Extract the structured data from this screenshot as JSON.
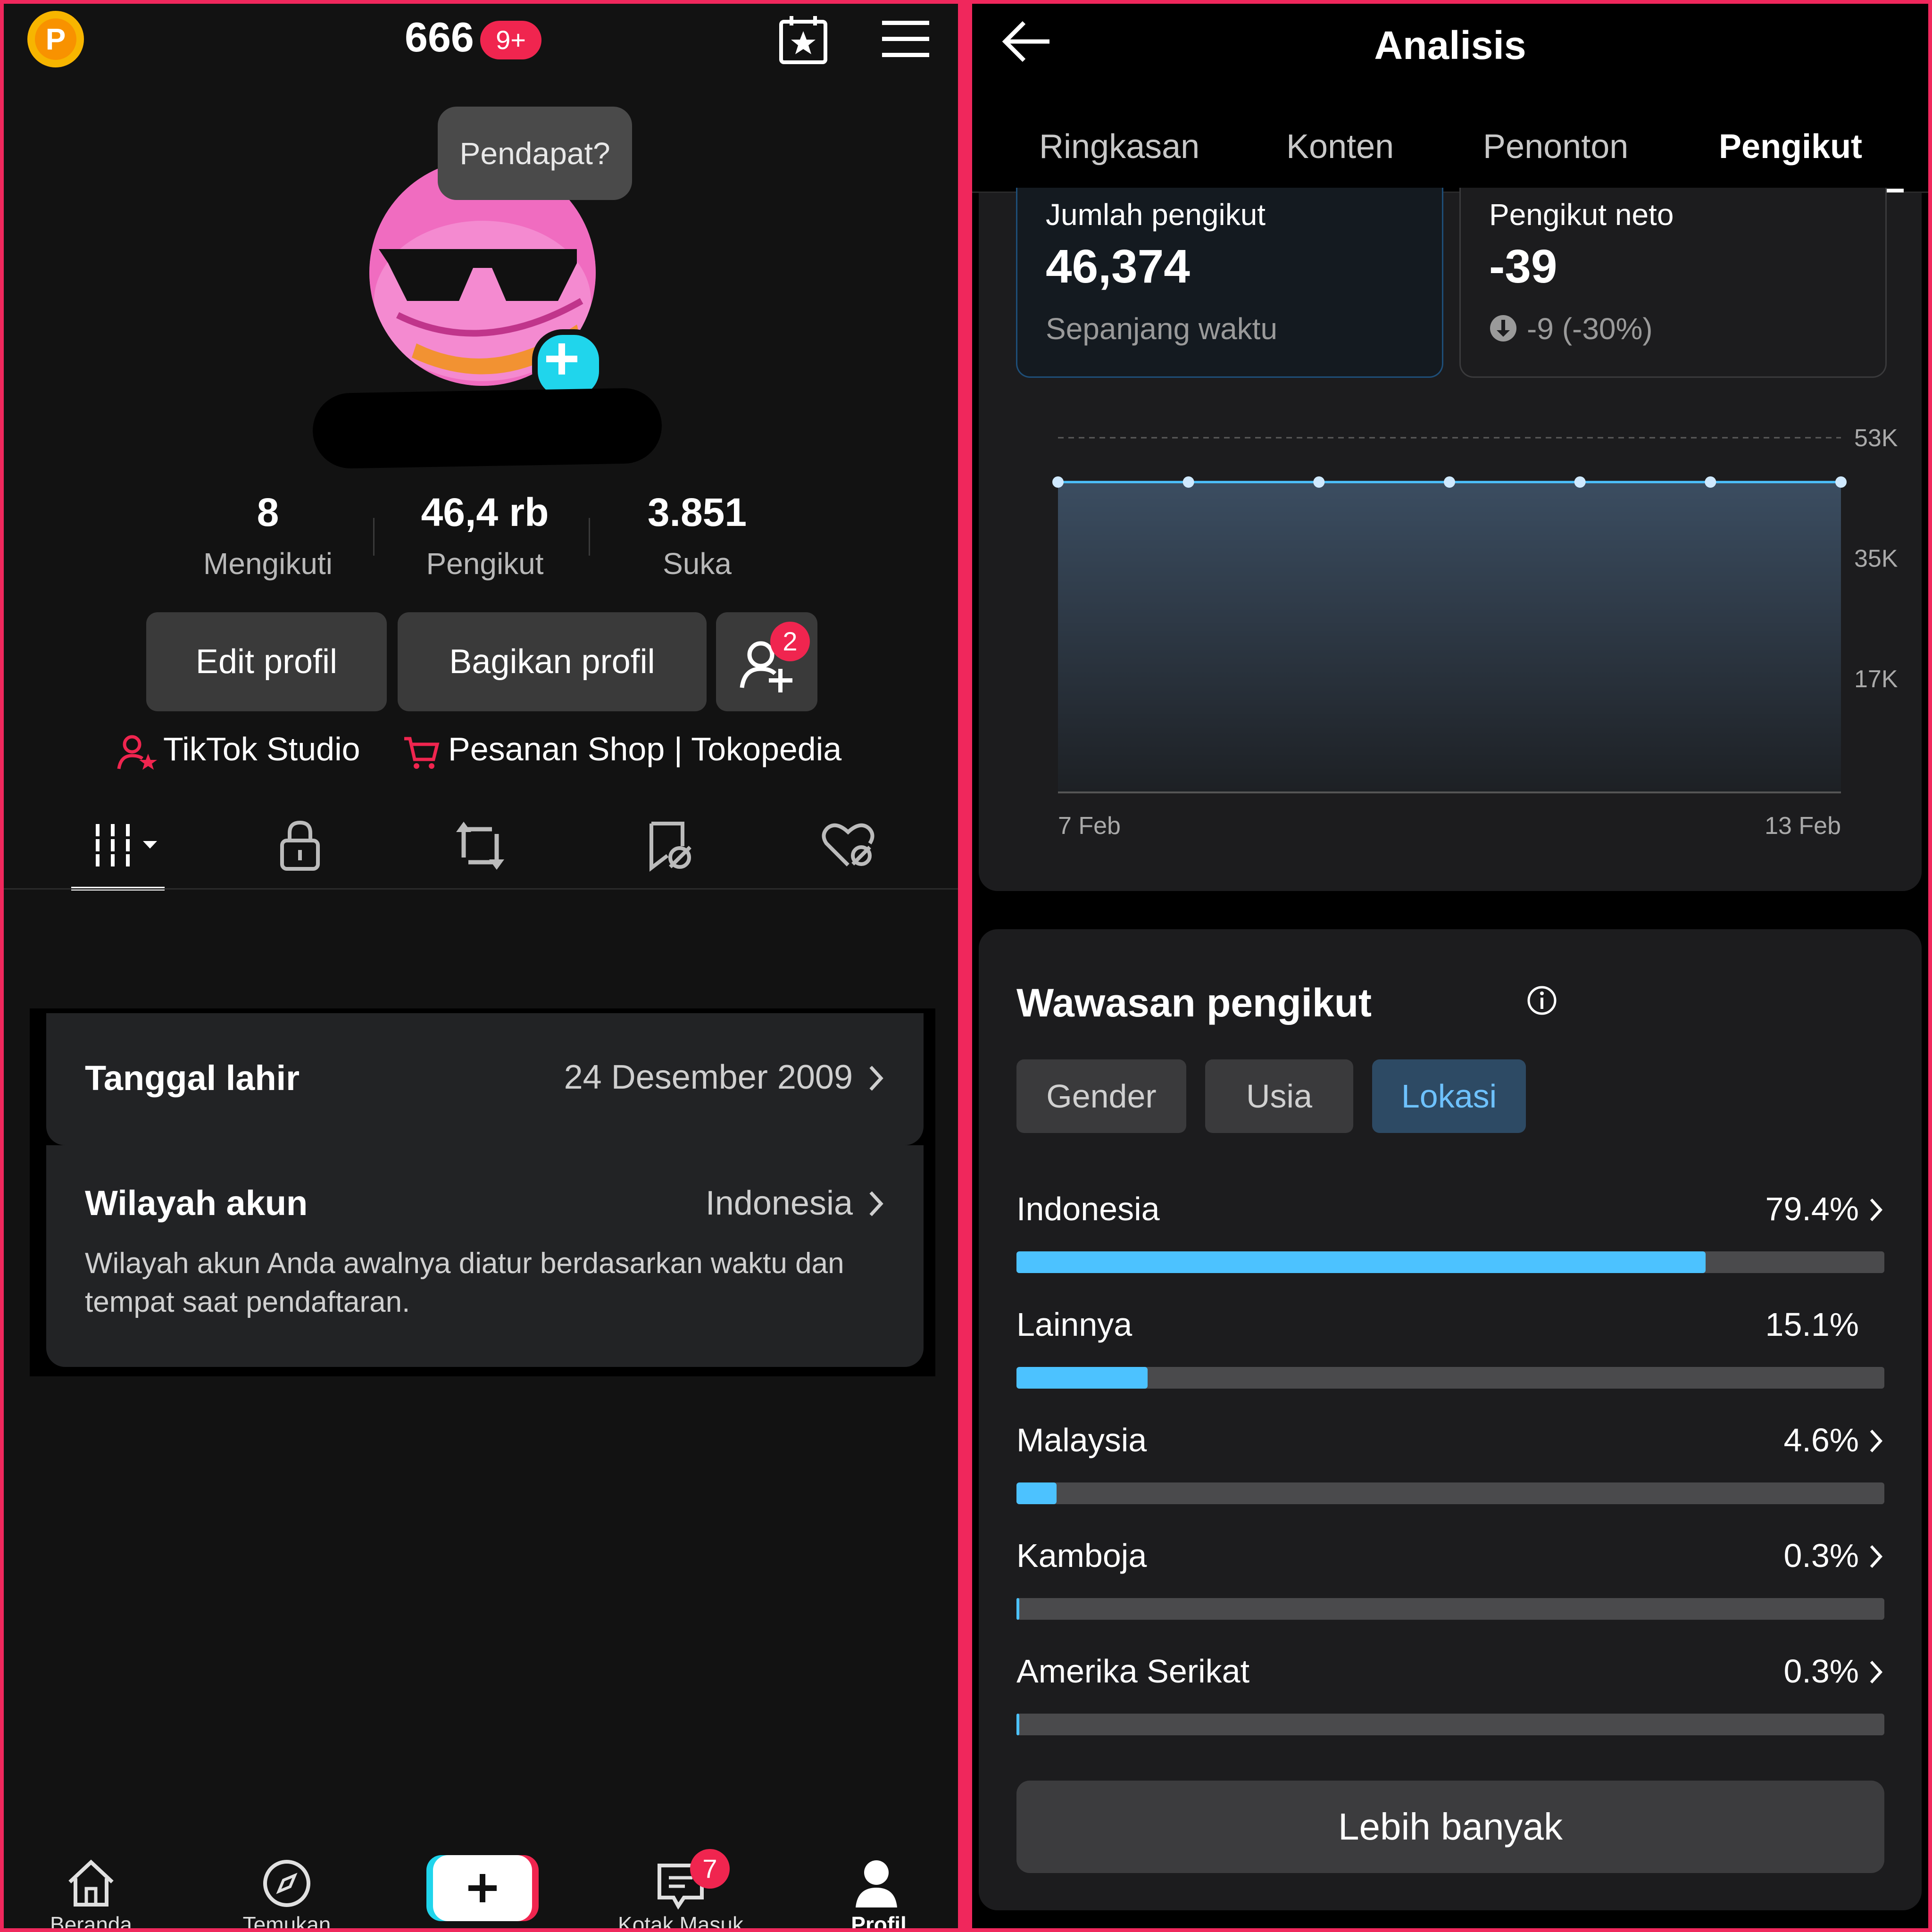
{
  "left": {
    "topbar": {
      "coin_label": "P",
      "count": "666",
      "count_badge": "9+"
    },
    "tooltip": "Pendapat?",
    "stats": [
      {
        "num": "8",
        "label": "Mengikuti"
      },
      {
        "num": "46,4 rb",
        "label": "Pengikut"
      },
      {
        "num": "3.851",
        "label": "Suka"
      }
    ],
    "buttons": {
      "edit": "Edit profil",
      "share": "Bagikan profil",
      "friend_badge": "2"
    },
    "links": {
      "studio": "TikTok Studio",
      "shop": "Pesanan Shop | Tokopedia"
    },
    "tab_icons": [
      "grid-icon",
      "lock-icon",
      "repost-icon",
      "bookmark-icon",
      "liked-icon"
    ],
    "birthday": {
      "title": "Tanggal lahir",
      "value": "24 Desember 2009"
    },
    "region": {
      "title": "Wilayah akun",
      "value": "Indonesia",
      "desc_line1": "Wilayah akun Anda awalnya diatur berdasarkan waktu dan",
      "desc_line2": "tempat saat pendaftaran."
    },
    "nav": {
      "home": "Beranda",
      "discover": "Temukan",
      "inbox": "Kotak Masuk",
      "inbox_badge": "7",
      "profile": "Profil"
    }
  },
  "right": {
    "title": "Analisis",
    "tabs": [
      "Ringkasan",
      "Konten",
      "Penonton",
      "Pengikut"
    ],
    "active_tab": "Pengikut",
    "total_card": {
      "label": "Jumlah pengikut",
      "value": "46,374",
      "sub": "Sepanjang waktu"
    },
    "net_card": {
      "label": "Pengikut neto",
      "value": "-39",
      "sub": "-9 (-30%)"
    },
    "chart_data": {
      "type": "area",
      "x": [
        "7 Feb",
        "8 Feb",
        "9 Feb",
        "10 Feb",
        "11 Feb",
        "12 Feb",
        "13 Feb"
      ],
      "x_tick_labels": [
        "7 Feb",
        "13 Feb"
      ],
      "values": [
        46374,
        46374,
        46374,
        46374,
        46374,
        46374,
        46374
      ],
      "y_ticks": [
        "53K",
        "35K",
        "17K"
      ],
      "ylim": [
        0,
        53000
      ],
      "grid": true,
      "title": "",
      "xlabel": "",
      "ylabel": ""
    },
    "insights": {
      "title": "Wawasan pengikut",
      "filters": [
        "Gender",
        "Usia",
        "Lokasi"
      ],
      "active_filter": "Lokasi",
      "locations": [
        {
          "name": "Indonesia",
          "pct": "79.4%",
          "value": 79.4,
          "chevron": true
        },
        {
          "name": "Lainnya",
          "pct": "15.1%",
          "value": 15.1,
          "chevron": false
        },
        {
          "name": "Malaysia",
          "pct": "4.6%",
          "value": 4.6,
          "chevron": true
        },
        {
          "name": "Kamboja",
          "pct": "0.3%",
          "value": 0.3,
          "chevron": true
        },
        {
          "name": "Amerika Serikat",
          "pct": "0.3%",
          "value": 0.3,
          "chevron": true
        }
      ],
      "more": "Lebih banyak"
    },
    "colors": {
      "accent": "#4cc2ff",
      "pill_active_bg": "#2d4a64",
      "brand_red": "#f0254f",
      "brand_cyan": "#20d5ec"
    }
  }
}
